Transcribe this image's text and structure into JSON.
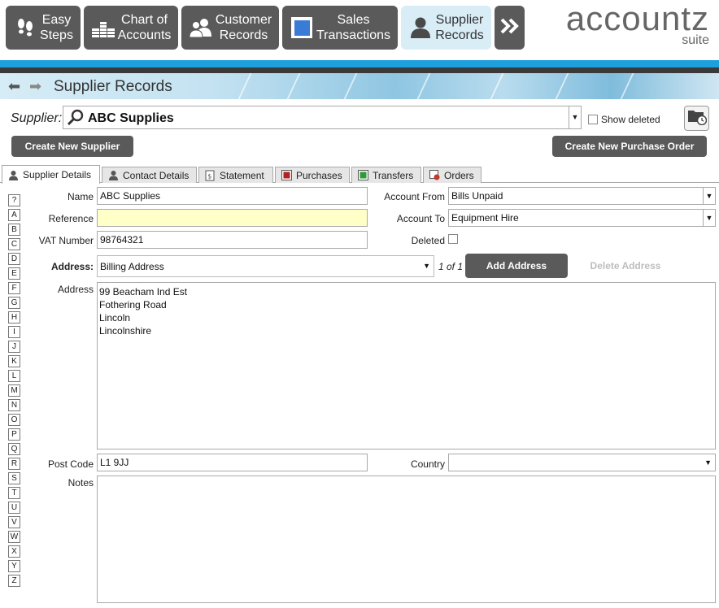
{
  "nav": {
    "buttons": [
      {
        "line1": "Easy",
        "line2": "Steps",
        "icon": "footprints-icon"
      },
      {
        "line1": "Chart of",
        "line2": "Accounts",
        "icon": "ledger-icon"
      },
      {
        "line1": "Customer",
        "line2": "Records",
        "icon": "customers-icon"
      },
      {
        "line1": "Sales",
        "line2": "Transactions",
        "icon": "book-icon"
      },
      {
        "line1": "Supplier",
        "line2": "Records",
        "icon": "supplier-icon"
      }
    ],
    "more_icon": "double-chevron-right-icon"
  },
  "logo": {
    "brand": "accountz",
    "sub": "suite"
  },
  "page_title": "Supplier Records",
  "supplier": {
    "label": "Supplier:",
    "value": "ABC Supplies",
    "show_deleted_label": "Show deleted",
    "show_deleted_checked": false
  },
  "actions": {
    "create_supplier": "Create New Supplier",
    "create_po": "Create New Purchase Order"
  },
  "tabs": [
    {
      "label": "Supplier Details",
      "icon": "person-icon"
    },
    {
      "label": "Contact Details",
      "icon": "person-icon"
    },
    {
      "label": "Statement",
      "icon": "statement-icon"
    },
    {
      "label": "Purchases",
      "icon": "red-box-icon"
    },
    {
      "label": "Transfers",
      "icon": "green-box-icon"
    },
    {
      "label": "Orders",
      "icon": "orders-icon"
    }
  ],
  "alpha_index": [
    "?",
    "A",
    "B",
    "C",
    "D",
    "E",
    "F",
    "G",
    "H",
    "I",
    "J",
    "K",
    "L",
    "M",
    "N",
    "O",
    "P",
    "Q",
    "R",
    "S",
    "T",
    "U",
    "V",
    "W",
    "X",
    "Y",
    "Z"
  ],
  "form": {
    "name_label": "Name",
    "name_value": "ABC Supplies",
    "reference_label": "Reference",
    "reference_value": "",
    "vat_label": "VAT Number",
    "vat_value": "98764321",
    "account_from_label": "Account From",
    "account_from_value": "Bills Unpaid",
    "account_to_label": "Account To",
    "account_to_value": "Equipment Hire",
    "deleted_label": "Deleted",
    "deleted_checked": false,
    "address_select_label": "Address:",
    "address_select_value": "Billing Address",
    "address_count": "1 of 1",
    "add_address": "Add Address",
    "delete_address": "Delete Address",
    "address_label": "Address",
    "address_lines": [
      "99 Beacham Ind Est",
      "Fothering Road",
      "Lincoln",
      "Lincolnshire"
    ],
    "postcode_label": "Post Code",
    "postcode_value": "L1 9JJ",
    "country_label": "Country",
    "country_value": "",
    "notes_label": "Notes",
    "notes_value": ""
  },
  "colors": {
    "nav_button": "#5a5a5a",
    "nav_active": "#d9edf7",
    "accent_blue": "#1ea0de",
    "reference_field": "#ffffc8"
  }
}
